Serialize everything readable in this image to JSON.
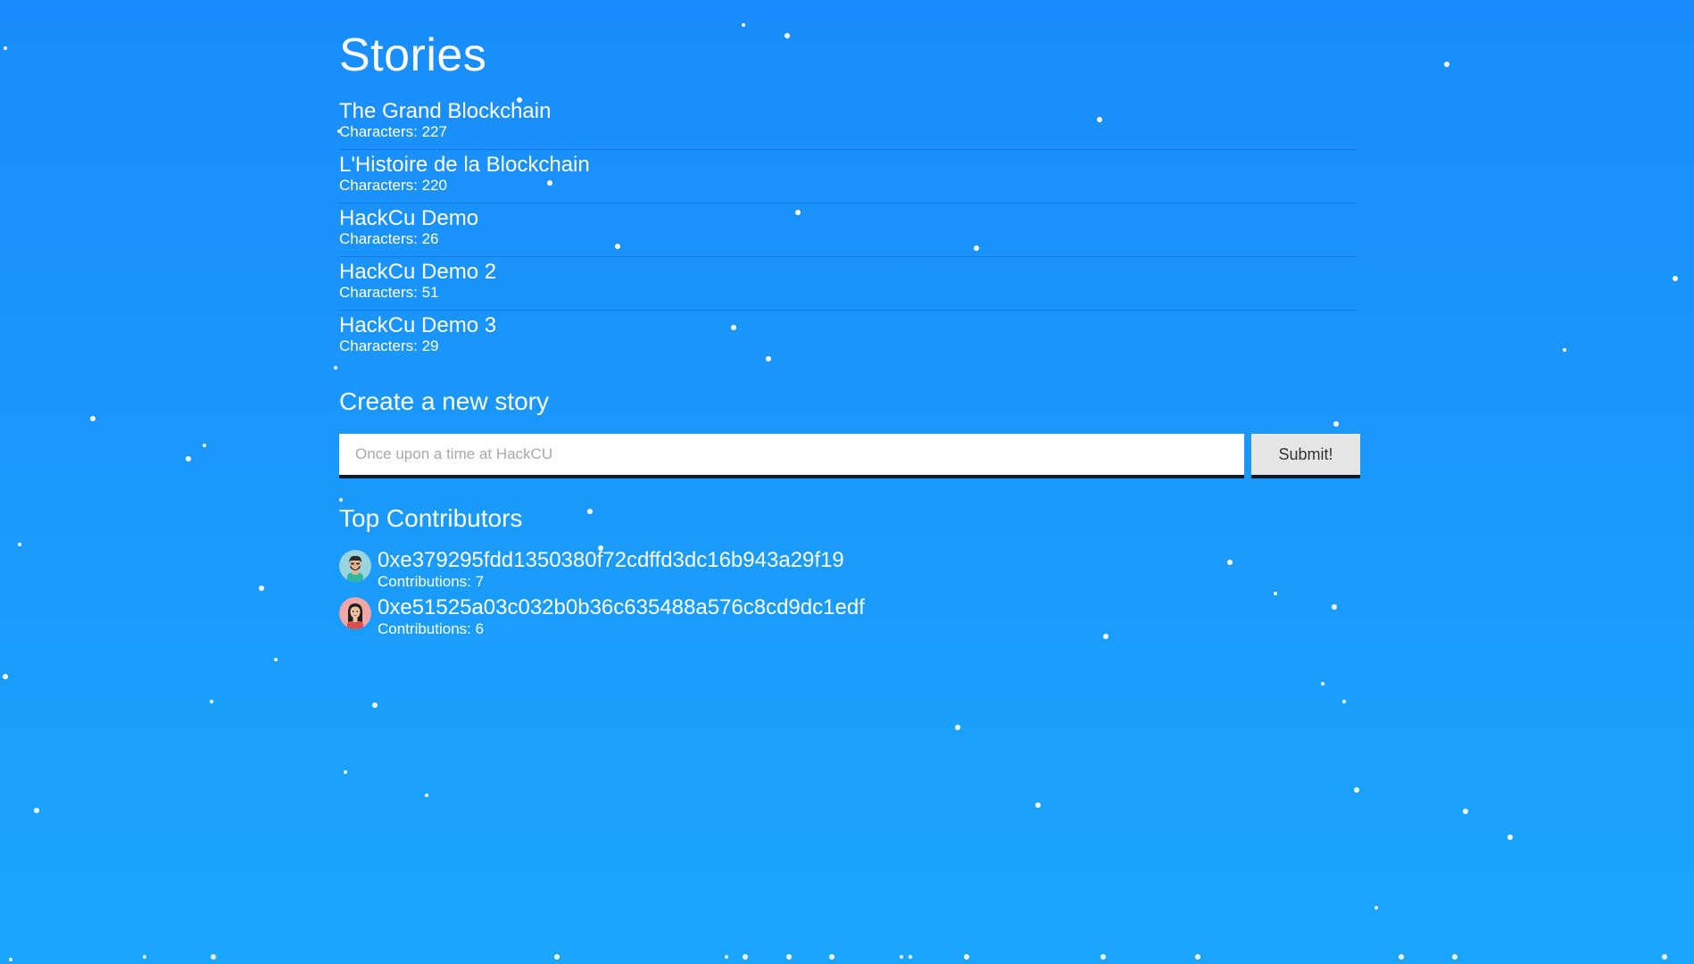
{
  "page": {
    "title": "Stories"
  },
  "stories": [
    {
      "title": "The Grand Blockchain",
      "characters": "Characters: 227"
    },
    {
      "title": "L'Histoire de la Blockchain",
      "characters": "Characters: 220"
    },
    {
      "title": "HackCu Demo",
      "characters": "Characters: 26"
    },
    {
      "title": "HackCu Demo 2",
      "characters": "Characters: 51"
    },
    {
      "title": "HackCu Demo 3",
      "characters": "Characters: 29"
    }
  ],
  "create": {
    "heading": "Create a new story",
    "placeholder": "Once upon a time at HackCU",
    "value": "",
    "submit_label": "Submit!"
  },
  "contributors": {
    "heading": "Top Contributors",
    "items": [
      {
        "address": "0xe379295fdd1350380f72cdffd3dc16b943a29f19",
        "contributions": "Contributions: 7",
        "avatar": "man-avatar-icon"
      },
      {
        "address": "0xe51525a03c032b0b36c635488a576c8cd9dc1edf",
        "contributions": "Contributions: 6",
        "avatar": "woman-avatar-icon"
      }
    ]
  },
  "colors": {
    "background_top": "#1a8cfd",
    "background_bottom": "#1aa6fd",
    "text": "#ffffff",
    "button_bg": "#e6e6e6"
  }
}
